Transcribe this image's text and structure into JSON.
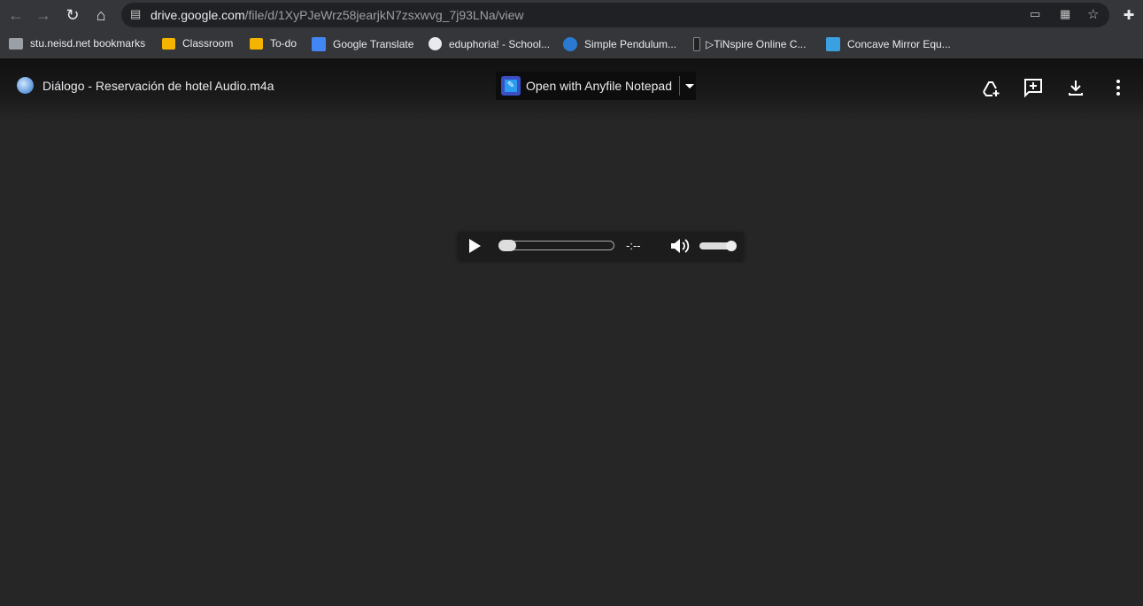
{
  "browser": {
    "url_domain": "drive.google.com",
    "url_path": "/file/d/1XyPJeWrz58jearjkN7zsxwvg_7j93LNa/view",
    "bookmarks": [
      {
        "label": "stu.neisd.net bookmarks",
        "icon": "folder-icon"
      },
      {
        "label": "Classroom",
        "icon": "classroom-icon"
      },
      {
        "label": "To-do",
        "icon": "classroom-icon"
      },
      {
        "label": "Google Translate",
        "icon": "translate-icon"
      },
      {
        "label": "eduphoria! - School...",
        "icon": "globe-icon"
      },
      {
        "label": "Simple Pendulum...",
        "icon": "phet-icon"
      },
      {
        "label": "▷TiNspire Online C...",
        "icon": "calculator-icon"
      },
      {
        "label": "Concave Mirror Equ...",
        "icon": "mirror-icon"
      }
    ]
  },
  "viewer": {
    "file_title": "Diálogo - Reservación de hotel Audio.m4a",
    "open_with_label": "Open with Anyfile Notepad"
  },
  "player": {
    "time": "-:--",
    "progress": 0,
    "volume": 1.0
  }
}
